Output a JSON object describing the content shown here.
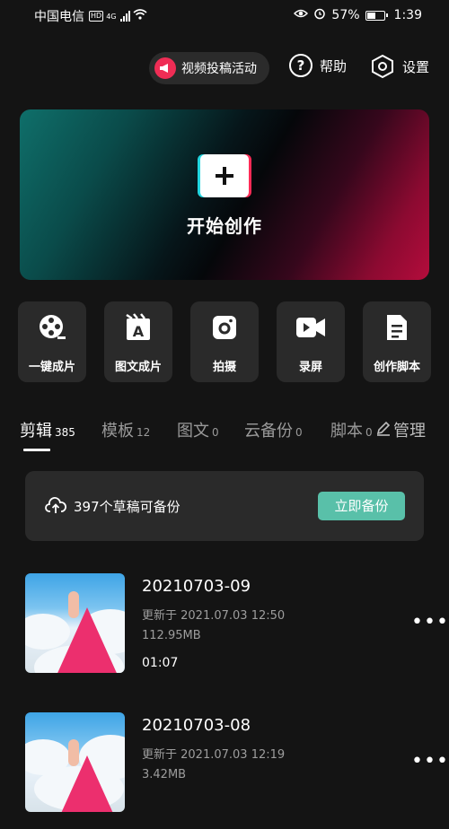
{
  "status_bar": {
    "carrier": "中国电信",
    "hd": "HD",
    "network": "4G",
    "battery": "57%",
    "battery_level": 0.57,
    "time": "1:39"
  },
  "top_bar": {
    "promo_label": "视频投稿活动",
    "help_label": "帮助",
    "settings_label": "设置"
  },
  "banner": {
    "title": "开始创作"
  },
  "tools": [
    {
      "label": "一键成片",
      "icon": "film-reel-icon"
    },
    {
      "label": "图文成片",
      "icon": "text-video-icon"
    },
    {
      "label": "拍摄",
      "icon": "camera-icon"
    },
    {
      "label": "录屏",
      "icon": "screen-record-icon"
    },
    {
      "label": "创作脚本",
      "icon": "script-doc-icon"
    }
  ],
  "tabs": [
    {
      "label": "剪辑",
      "count": "385"
    },
    {
      "label": "模板",
      "count": "12"
    },
    {
      "label": "图文",
      "count": "0"
    },
    {
      "label": "云备份",
      "count": "0"
    },
    {
      "label": "脚本",
      "count": "0"
    }
  ],
  "manage_label": "管理",
  "backup": {
    "message": "397个草稿可备份",
    "button": "立即备份"
  },
  "drafts": [
    {
      "title": "20210703-09",
      "updated": "更新于 2021.07.03 12:50",
      "size": "112.95MB",
      "duration": "01:07"
    },
    {
      "title": "20210703-08",
      "updated": "更新于 2021.07.03 12:19",
      "size": "3.42MB",
      "duration": ""
    }
  ],
  "colors": {
    "background": "#141414",
    "card": "#2a2a2a",
    "accent_teal": "#59c0a9",
    "promo_red": "#ef2d55"
  }
}
